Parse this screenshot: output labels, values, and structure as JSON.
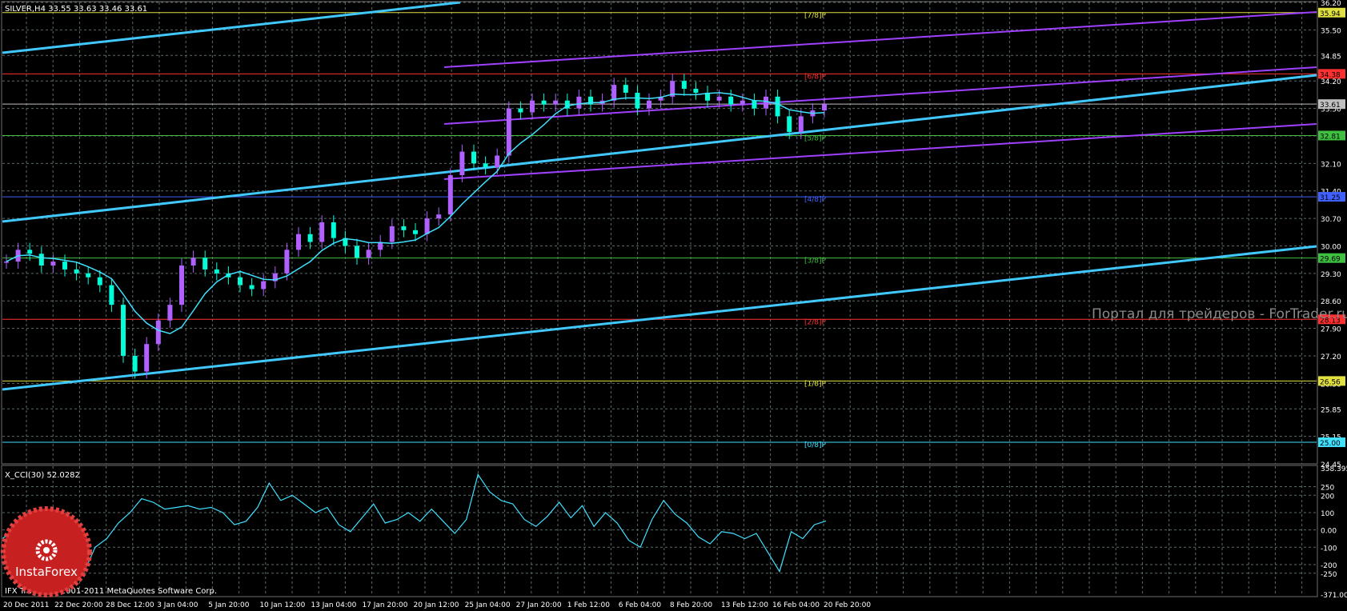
{
  "main_header": "SILVER,H4  33.55 33.63 33.46 33.61",
  "cci_header": "X_CCI(30) 52.0282",
  "copyright": "IFX Trader, © 2001-2011 MetaQuotes Software Corp.",
  "watermark": "Портал для трейдеров - ForTrader.ru",
  "logo_text": "InstaForex",
  "colors": {
    "background": "#000000",
    "grid": "#5a6a6a",
    "candle": "#00ffd8",
    "candle_alt": "#b060ff",
    "ma": "#40e0ff",
    "trend": "#40c8ff",
    "channel": "#a040ff",
    "cci": "#40e0ff"
  },
  "chart_data": [
    {
      "type": "candlestick",
      "symbol": "SILVER",
      "timeframe": "H4",
      "last_bar": {
        "open": 33.55,
        "high": 33.63,
        "low": 33.46,
        "close": 33.61
      },
      "ylim": [
        24.45,
        36.2
      ],
      "y_ticks": [
        "36.20",
        "35.50",
        "34.85",
        "34.20",
        "33.50",
        "32.80",
        "32.10",
        "31.40",
        "30.70",
        "30.00",
        "29.30",
        "28.60",
        "27.90",
        "27.20",
        "26.50",
        "25.85",
        "25.15",
        "24.45"
      ],
      "x_ticks": [
        "20 Dec 2011",
        "22 Dec 20:00",
        "28 Dec 12:00",
        "3 Jan 04:00",
        "5 Jan 20:00",
        "10 Jan 12:00",
        "13 Jan 04:00",
        "17 Jan 20:00",
        "20 Jan 12:00",
        "25 Jan 04:00",
        "27 Jan 20:00",
        "1 Feb 12:00",
        "6 Feb 04:00",
        "8 Feb 20:00",
        "13 Feb 12:00",
        "16 Feb 04:00",
        "20 Feb 20:00"
      ],
      "close_series": [
        29.6,
        29.9,
        29.8,
        29.5,
        29.6,
        29.4,
        29.3,
        29.2,
        29.0,
        28.5,
        27.2,
        26.8,
        27.5,
        28.1,
        28.5,
        29.5,
        29.7,
        29.4,
        29.3,
        29.2,
        29.0,
        28.9,
        29.1,
        29.3,
        29.9,
        30.3,
        30.1,
        30.6,
        30.2,
        30.0,
        29.7,
        29.9,
        30.1,
        30.5,
        30.4,
        30.3,
        30.7,
        30.8,
        31.8,
        32.4,
        32.1,
        32.0,
        32.3,
        33.5,
        33.4,
        33.7,
        33.6,
        33.7,
        33.5,
        33.8,
        33.6,
        33.7,
        34.1,
        33.9,
        33.5,
        33.7,
        33.8,
        34.2,
        34.0,
        33.9,
        33.7,
        33.8,
        33.6,
        33.7,
        33.5,
        33.8,
        33.3,
        32.9,
        33.3,
        33.45,
        33.61
      ],
      "horizontal_levels": [
        {
          "price": 35.94,
          "label": "[7/8]P",
          "price_label": "35.94",
          "color": "#e0e040"
        },
        {
          "price": 34.38,
          "label": "[6/8]P",
          "price_label": "34.38",
          "color": "#ff3030"
        },
        {
          "price": 33.61,
          "label": "",
          "price_label": "33.61",
          "color": "#c0c0c0"
        },
        {
          "price": 32.81,
          "label": "[5/8]P",
          "price_label": "32.81",
          "color": "#40c040"
        },
        {
          "price": 31.25,
          "label": "[4/8]P",
          "price_label": "31.25",
          "color": "#4060ff"
        },
        {
          "price": 29.69,
          "label": "[3/8]P",
          "price_label": "29.69",
          "color": "#40c040"
        },
        {
          "price": 28.13,
          "label": "[2/8]P",
          "price_label": "28.13",
          "color": "#ff3030"
        },
        {
          "price": 26.56,
          "label": "[1/8]P",
          "price_label": "26.56",
          "color": "#e0e040"
        },
        {
          "price": 25.0,
          "label": "[0/8]P",
          "price_label": "25.00",
          "color": "#40e0ff"
        }
      ]
    },
    {
      "type": "line",
      "name": "X_CCI(30)",
      "current_value": 52.0282,
      "ylim": [
        -371.002,
        358.395
      ],
      "y_ticks": [
        "358.395",
        "250",
        "200",
        "100",
        "0.00",
        "-100",
        "-200",
        "-250",
        "-371.002"
      ],
      "values": [
        -50,
        0,
        60,
        110,
        70,
        0,
        -150,
        -250,
        -100,
        -50,
        40,
        100,
        180,
        160,
        120,
        130,
        140,
        120,
        130,
        100,
        30,
        50,
        130,
        270,
        170,
        200,
        150,
        100,
        130,
        30,
        -10,
        70,
        150,
        40,
        60,
        100,
        50,
        120,
        50,
        -20,
        60,
        320,
        220,
        170,
        150,
        60,
        20,
        80,
        160,
        70,
        140,
        20,
        100,
        40,
        -60,
        -100,
        60,
        170,
        90,
        40,
        -40,
        -80,
        -10,
        -20,
        -50,
        -20,
        -130,
        -240,
        -10,
        -50,
        30,
        52
      ]
    }
  ]
}
